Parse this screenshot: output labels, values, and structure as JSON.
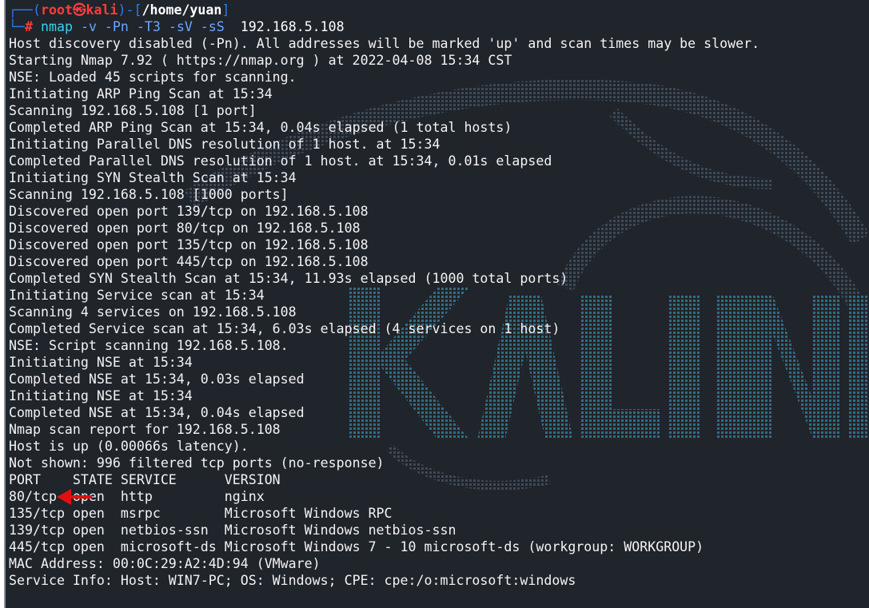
{
  "prompt": {
    "corner_top": "┌──(",
    "user": "root",
    "at_symbol": "㉿",
    "host": "kali",
    "mid": ")-[",
    "path": "/home/yuan",
    "end": "]",
    "corner_bottom": "└─",
    "hash": "#",
    "command": "nmap",
    "flags": "-v -Pn -T3 -sV -sS",
    "target": "192.168.5.108"
  },
  "output_lines": [
    "Host discovery disabled (-Pn). All addresses will be marked 'up' and scan times may be slower.",
    "Starting Nmap 7.92 ( https://nmap.org ) at 2022-04-08 15:34 CST",
    "NSE: Loaded 45 scripts for scanning.",
    "Initiating ARP Ping Scan at 15:34",
    "Scanning 192.168.5.108 [1 port]",
    "Completed ARP Ping Scan at 15:34, 0.04s elapsed (1 total hosts)",
    "Initiating Parallel DNS resolution of 1 host. at 15:34",
    "Completed Parallel DNS resolution of 1 host. at 15:34, 0.01s elapsed",
    "Initiating SYN Stealth Scan at 15:34",
    "Scanning 192.168.5.108 [1000 ports]",
    "Discovered open port 139/tcp on 192.168.5.108",
    "Discovered open port 80/tcp on 192.168.5.108",
    "Discovered open port 135/tcp on 192.168.5.108",
    "Discovered open port 445/tcp on 192.168.5.108",
    "Completed SYN Stealth Scan at 15:34, 11.93s elapsed (1000 total ports)",
    "Initiating Service scan at 15:34",
    "Scanning 4 services on 192.168.5.108",
    "Completed Service scan at 15:34, 6.03s elapsed (4 services on 1 host)",
    "NSE: Script scanning 192.168.5.108.",
    "Initiating NSE at 15:34",
    "Completed NSE at 15:34, 0.03s elapsed",
    "Initiating NSE at 15:34",
    "Completed NSE at 15:34, 0.04s elapsed",
    "Nmap scan report for 192.168.5.108",
    "Host is up (0.00066s latency).",
    "Not shown: 996 filtered tcp ports (no-response)",
    "PORT    STATE SERVICE      VERSION",
    "80/tcp  open  http         nginx",
    "135/tcp open  msrpc        Microsoft Windows RPC",
    "139/tcp open  netbios-ssn  Microsoft Windows netbios-ssn",
    "445/tcp open  microsoft-ds Microsoft Windows 7 - 10 microsoft-ds (workgroup: WORKGROUP)",
    "MAC Address: 00:0C:29:A2:4D:94 (VMware)",
    "Service Info: Host: WIN7-PC; OS: Windows; CPE: cpe:/o:microsoft:windows"
  ],
  "watermark": {
    "text": "KALI LINUX",
    "color": "#2a5f7a"
  },
  "colors": {
    "background": "#20242b",
    "prompt_box": "#2d7cf1",
    "user": "#ff3b3b",
    "command": "#39d0f0",
    "flags": "#6aa6ff",
    "arrow": "#e01010"
  },
  "annotation_icon": "red-arrow-icon"
}
